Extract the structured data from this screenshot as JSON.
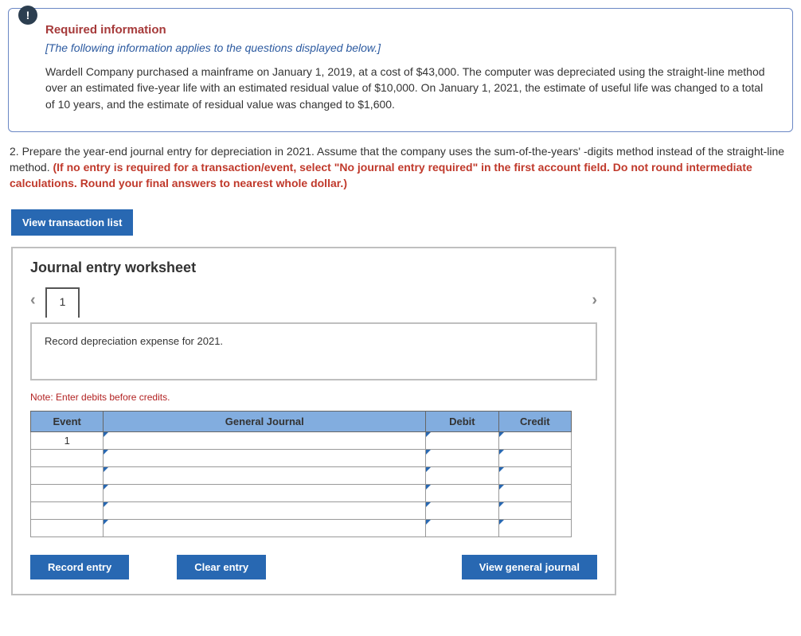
{
  "badge": "!",
  "required": {
    "title": "Required information",
    "subtitle": "[The following information applies to the questions displayed below.]",
    "body": "Wardell Company purchased a mainframe on January 1, 2019, at a cost of $43,000. The computer was depreciated using the straight-line method over an estimated five-year life with an estimated residual value of $10,000. On January 1, 2021, the estimate of useful life was changed to a total of 10 years, and the estimate of residual value was changed to $1,600."
  },
  "question": {
    "lead": "2. Prepare the year-end journal entry for depreciation in 2021. Assume that the company uses the sum-of-the-years' -digits method instead of the straight-line method. ",
    "red": "(If no entry is required for a transaction/event, select \"No journal entry required\" in the first account field. Do not round intermediate calculations. Round your final answers to nearest whole dollar.)"
  },
  "buttons": {
    "view_list": "View transaction list",
    "record": "Record entry",
    "clear": "Clear entry",
    "view_journal": "View general journal"
  },
  "worksheet": {
    "title": "Journal entry worksheet",
    "tab": "1",
    "description": "Record depreciation expense for 2021.",
    "note": "Note: Enter debits before credits.",
    "headers": {
      "event": "Event",
      "gj": "General Journal",
      "debit": "Debit",
      "credit": "Credit"
    },
    "rows": [
      {
        "event": "1",
        "gj": "",
        "debit": "",
        "credit": ""
      },
      {
        "event": "",
        "gj": "",
        "debit": "",
        "credit": ""
      },
      {
        "event": "",
        "gj": "",
        "debit": "",
        "credit": ""
      },
      {
        "event": "",
        "gj": "",
        "debit": "",
        "credit": ""
      },
      {
        "event": "",
        "gj": "",
        "debit": "",
        "credit": ""
      },
      {
        "event": "",
        "gj": "",
        "debit": "",
        "credit": ""
      }
    ]
  }
}
